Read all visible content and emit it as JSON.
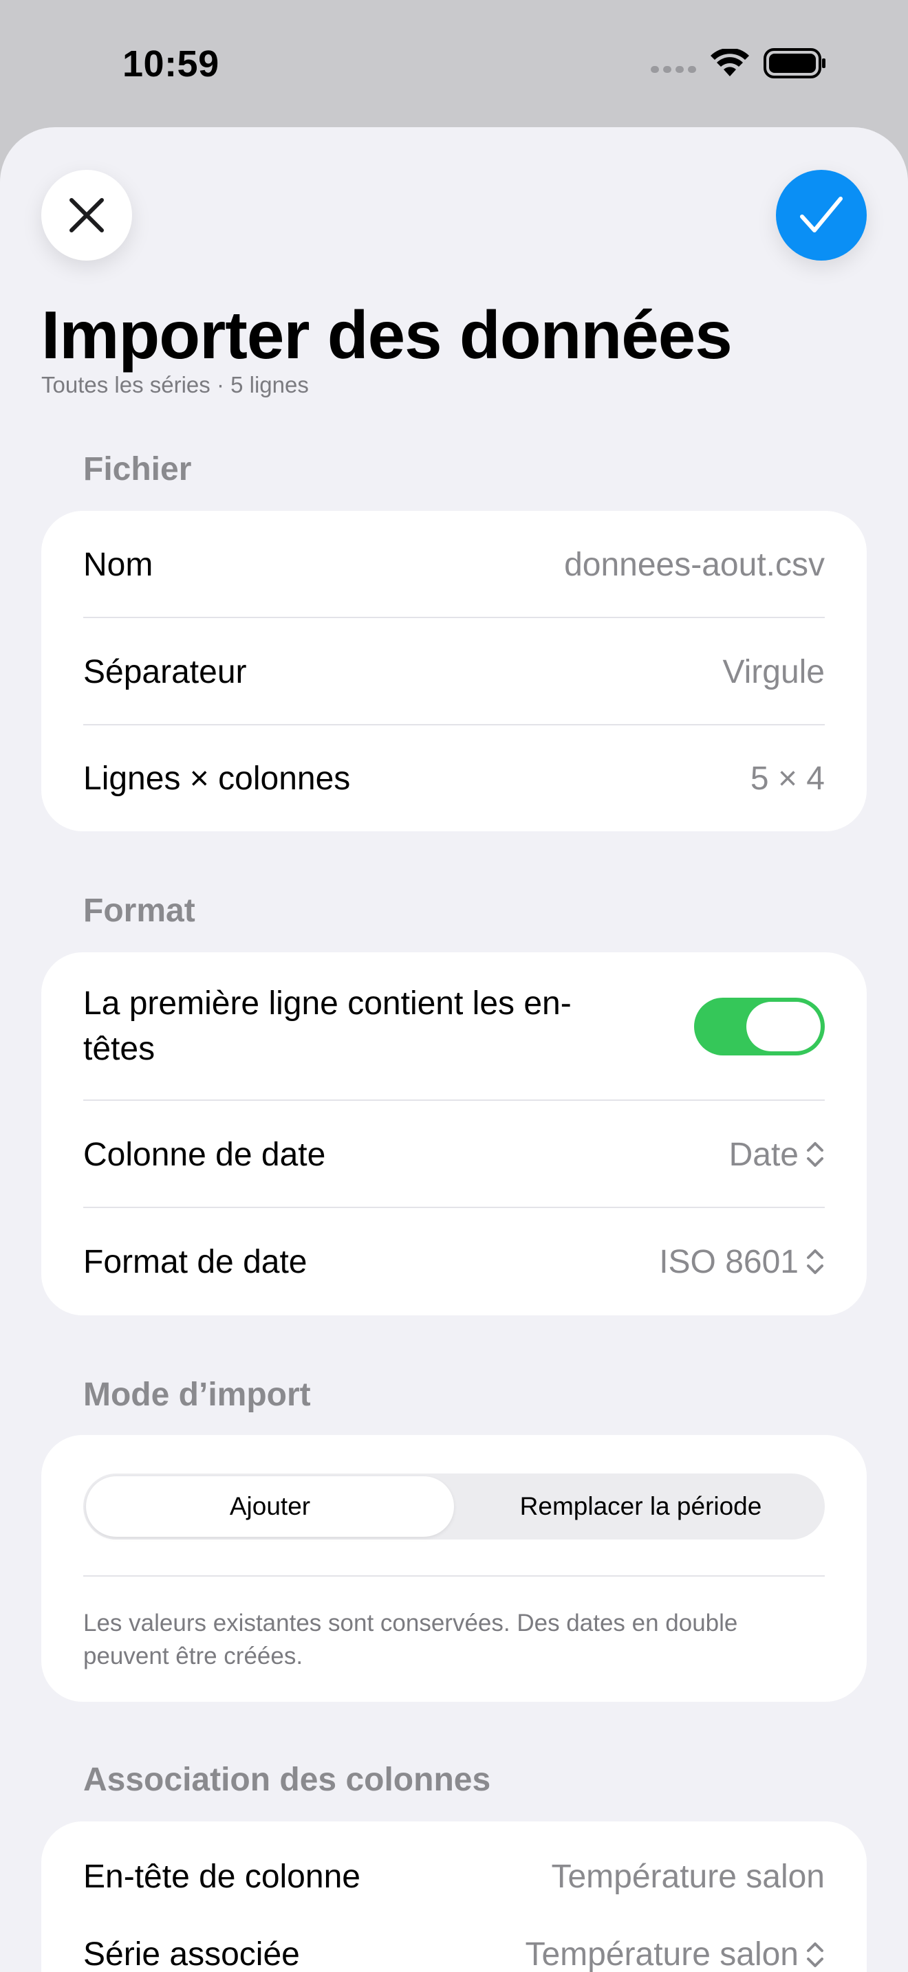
{
  "status_bar": {
    "time": "10:59",
    "icons": [
      "cellular-signal-icon",
      "wifi-icon",
      "battery-icon"
    ]
  },
  "header": {
    "close_icon": "close-icon",
    "confirm_icon": "checkmark-icon",
    "title": "Importer des données",
    "subtitle": "Toutes les séries · 5 lignes"
  },
  "sections": {
    "file": {
      "header": "Fichier",
      "rows": [
        {
          "label": "Nom",
          "value": "donnees-aout.csv"
        },
        {
          "label": "Séparateur",
          "value": "Virgule"
        },
        {
          "label": "Lignes × colonnes",
          "value": "5 × 4"
        }
      ]
    },
    "format": {
      "header": "Format",
      "first_row_headers_label": "La première ligne contient les en-têtes",
      "first_row_headers_on": true,
      "date_column": {
        "label": "Colonne de date",
        "value": "Date"
      },
      "date_format": {
        "label": "Format de date",
        "value": "ISO 8601"
      }
    },
    "import_mode": {
      "header": "Mode d’import",
      "options": [
        "Ajouter",
        "Remplacer la période"
      ],
      "selected": "Ajouter",
      "note": "Les valeurs existantes sont conservées. Des dates en double peuvent être créées."
    },
    "mapping": {
      "header": "Association des colonnes",
      "column_header": {
        "label": "En-tête de colonne",
        "value": "Température salon"
      },
      "series": {
        "label": "Série associée",
        "value": "Température salon"
      }
    }
  },
  "colors": {
    "accent": "#0a8ff5",
    "toggle_on": "#35c759",
    "background": "#f1f1f6"
  }
}
